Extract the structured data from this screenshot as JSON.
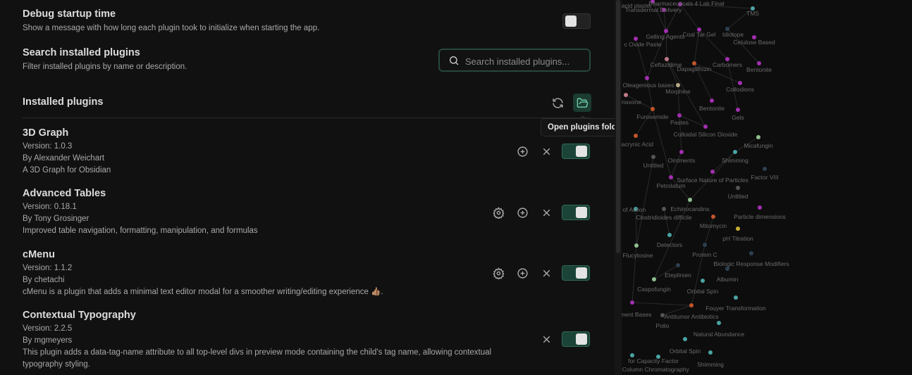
{
  "debug": {
    "name": "Debug startup time",
    "desc": "Show a message with how long each plugin took to initialize when starting the app.",
    "enabled": false
  },
  "search": {
    "name": "Search installed plugins",
    "desc": "Filter installed plugins by name or description.",
    "placeholder": "Search installed plugins..."
  },
  "installed": {
    "title": "Installed plugins",
    "tooltip": "Open plugins folder"
  },
  "plugins": [
    {
      "name": "3D Graph",
      "version": "Version: 1.0.3",
      "author": "By Alexander Weichart",
      "desc": "A 3D Graph for Obsidian",
      "enabled": true
    },
    {
      "name": "Advanced Tables",
      "version": "Version: 0.18.1",
      "author": "By Tony Grosinger",
      "desc": "Improved table navigation, formatting, manipulation, and formulas",
      "enabled": true
    },
    {
      "name": "cMenu",
      "version": "Version: 1.1.2",
      "author": "By chetachi",
      "desc": "cMenu is a plugin that adds a minimal text editor modal for a smoother writing/editing experience 👍🏽.",
      "enabled": true
    },
    {
      "name": "Contextual Typography",
      "version": "Version: 2.2.5",
      "author": "By mgmeyers",
      "desc": "This plugin adds a data-tag-name attribute to all top-level divs in preview mode containing the child's tag name, allowing contextual typography styling.",
      "enabled": true
    }
  ],
  "colors": {
    "accent": "#1c4337",
    "purple": "#a22fb0",
    "orange": "#c2552a",
    "teal": "#4aa3a3",
    "green": "#8fbf8f",
    "gray": "#555555",
    "navy": "#2e4050",
    "pink": "#c07a8a",
    "tan": "#b8a888",
    "yellow": "#c8b030"
  },
  "graph_nodes": [
    {
      "label": "Salicylic acid plaster",
      "color": "purple"
    },
    {
      "label": "Pharmaceuticals 4 Lab Final",
      "color": "purple"
    },
    {
      "label": "Transdermal Delivery",
      "color": "purple"
    },
    {
      "label": "TMS",
      "color": "teal"
    },
    {
      "label": "Gelling Agents",
      "color": "purple"
    },
    {
      "label": "Coal Tar Gel",
      "color": "purple"
    },
    {
      "label": "Idiotope",
      "color": "navy"
    },
    {
      "label": "Celulose Based",
      "color": "purple"
    },
    {
      "label": "c Oxide Paste",
      "color": "purple"
    },
    {
      "label": "Ceftazidime",
      "color": "pink"
    },
    {
      "label": "Dapagliflozin",
      "color": "orange"
    },
    {
      "label": "Carbomers",
      "color": "purple"
    },
    {
      "label": "Bentonite",
      "color": "purple"
    },
    {
      "label": "Oleagenious bases",
      "color": "purple"
    },
    {
      "label": "Morphine",
      "color": "tan"
    },
    {
      "label": "Collodions",
      "color": "purple"
    },
    {
      "label": "riaxone",
      "color": "pink"
    },
    {
      "label": "Bentonite",
      "color": "purple"
    },
    {
      "label": "Furosemide",
      "color": "orange"
    },
    {
      "label": "Pastes",
      "color": "purple"
    },
    {
      "label": "Gels",
      "color": "purple"
    },
    {
      "label": "Colloidal Silicon Dioxide",
      "color": "purple"
    },
    {
      "label": "Micafungin",
      "color": "green"
    },
    {
      "label": "nacrynic Acid",
      "color": "orange"
    },
    {
      "label": "Untitled",
      "color": "gray"
    },
    {
      "label": "Ointments",
      "color": "purple"
    },
    {
      "label": "Shimming",
      "color": "teal"
    },
    {
      "label": "Factor VIII",
      "color": "navy"
    },
    {
      "label": "Surface Nature of Particles",
      "color": "purple"
    },
    {
      "label": "Petrolatum",
      "color": "purple"
    },
    {
      "label": "Untitled",
      "color": "gray"
    },
    {
      "label": "Echinocandins",
      "color": "green"
    },
    {
      "label": "Particle dimensions",
      "color": "purple"
    },
    {
      "label": "Clostridioides difficile",
      "color": "gray"
    },
    {
      "label": "Mitomycin",
      "color": "orange"
    },
    {
      "label": "pH Titration",
      "color": "yellow"
    },
    {
      "label": "Detectors",
      "color": "teal"
    },
    {
      "label": "Flucytosine",
      "color": "green"
    },
    {
      "label": "Protein C",
      "color": "navy"
    },
    {
      "label": "Biologic Response Modifiers",
      "color": "navy"
    },
    {
      "label": "Eteplirsen",
      "color": "navy"
    },
    {
      "label": "Albumin",
      "color": "navy"
    },
    {
      "label": "Caspofungin",
      "color": "green"
    },
    {
      "label": "Orbital Spin",
      "color": "teal"
    },
    {
      "label": "Fouyer Transformation",
      "color": "teal"
    },
    {
      "label": "Antitumor Antibiotics",
      "color": "orange"
    },
    {
      "label": "ment Bases",
      "color": "purple"
    },
    {
      "label": "Polio",
      "color": "gray"
    },
    {
      "label": "Natural Abundance",
      "color": "teal"
    },
    {
      "label": "Orbital Spin",
      "color": "teal"
    },
    {
      "label": "Shimming",
      "color": "teal"
    },
    {
      "label": "for Capacity Factor",
      "color": "teal"
    },
    {
      "label": "pen Column Chromatography",
      "color": "teal"
    },
    {
      "label": "ism of Action",
      "color": "teal"
    }
  ]
}
